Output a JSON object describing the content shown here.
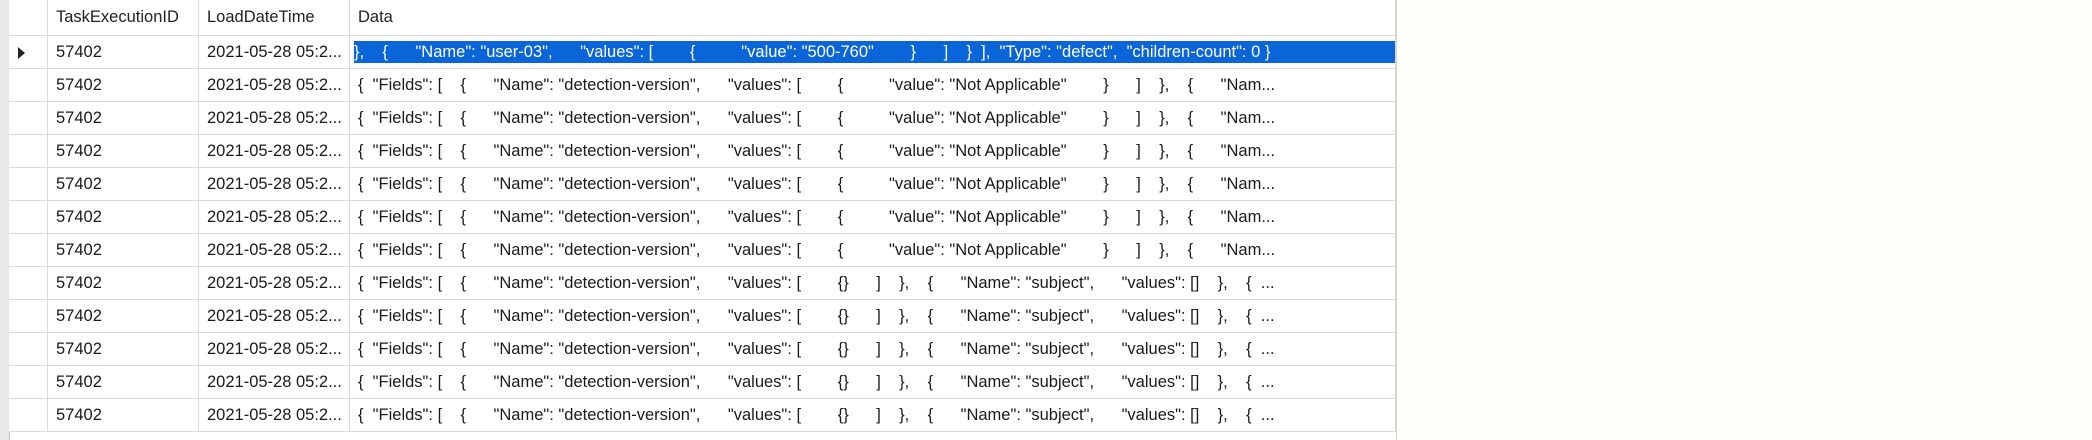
{
  "grid": {
    "columns": [
      "TaskExecutionID",
      "LoadDateTime",
      "Data"
    ],
    "selected_row_index": 0,
    "rows": [
      {
        "id": "57402",
        "datetime": "2021-05-28 05:2...",
        "data": "},    {      \"Name\": \"user-03\",      \"values\": [        {          \"value\": \"500-760\"        }      ]    }  ],  \"Type\": \"defect\",  \"children-count\": 0 }"
      },
      {
        "id": "57402",
        "datetime": "2021-05-28 05:2...",
        "data": "{  \"Fields\": [    {      \"Name\": \"detection-version\",      \"values\": [        {          \"value\": \"Not Applicable\"        }      ]    },    {      \"Nam..."
      },
      {
        "id": "57402",
        "datetime": "2021-05-28 05:2...",
        "data": "{  \"Fields\": [    {      \"Name\": \"detection-version\",      \"values\": [        {          \"value\": \"Not Applicable\"        }      ]    },    {      \"Nam..."
      },
      {
        "id": "57402",
        "datetime": "2021-05-28 05:2...",
        "data": "{  \"Fields\": [    {      \"Name\": \"detection-version\",      \"values\": [        {          \"value\": \"Not Applicable\"        }      ]    },    {      \"Nam..."
      },
      {
        "id": "57402",
        "datetime": "2021-05-28 05:2...",
        "data": "{  \"Fields\": [    {      \"Name\": \"detection-version\",      \"values\": [        {          \"value\": \"Not Applicable\"        }      ]    },    {      \"Nam..."
      },
      {
        "id": "57402",
        "datetime": "2021-05-28 05:2...",
        "data": "{  \"Fields\": [    {      \"Name\": \"detection-version\",      \"values\": [        {          \"value\": \"Not Applicable\"        }      ]    },    {      \"Nam..."
      },
      {
        "id": "57402",
        "datetime": "2021-05-28 05:2...",
        "data": "{  \"Fields\": [    {      \"Name\": \"detection-version\",      \"values\": [        {          \"value\": \"Not Applicable\"        }      ]    },    {      \"Nam..."
      },
      {
        "id": "57402",
        "datetime": "2021-05-28 05:2...",
        "data": "{  \"Fields\": [    {      \"Name\": \"detection-version\",      \"values\": [        {}      ]    },    {      \"Name\": \"subject\",      \"values\": []    },    {  ..."
      },
      {
        "id": "57402",
        "datetime": "2021-05-28 05:2...",
        "data": "{  \"Fields\": [    {      \"Name\": \"detection-version\",      \"values\": [        {}      ]    },    {      \"Name\": \"subject\",      \"values\": []    },    {  ..."
      },
      {
        "id": "57402",
        "datetime": "2021-05-28 05:2...",
        "data": "{  \"Fields\": [    {      \"Name\": \"detection-version\",      \"values\": [        {}      ]    },    {      \"Name\": \"subject\",      \"values\": []    },    {  ..."
      },
      {
        "id": "57402",
        "datetime": "2021-05-28 05:2...",
        "data": "{  \"Fields\": [    {      \"Name\": \"detection-version\",      \"values\": [        {}      ]    },    {      \"Name\": \"subject\",      \"values\": []    },    {  ..."
      },
      {
        "id": "57402",
        "datetime": "2021-05-28 05:2...",
        "data": "{  \"Fields\": [    {      \"Name\": \"detection-version\",      \"values\": [        {}      ]    },    {      \"Name\": \"subject\",      \"values\": []    },    {  ..."
      }
    ]
  },
  "colors": {
    "selection_bg": "#0a66d8",
    "selection_fg": "#ffffff",
    "gridline": "#dadada",
    "background": "#fefef9"
  },
  "icons": {
    "current_row": "row-selector-arrow-icon"
  }
}
